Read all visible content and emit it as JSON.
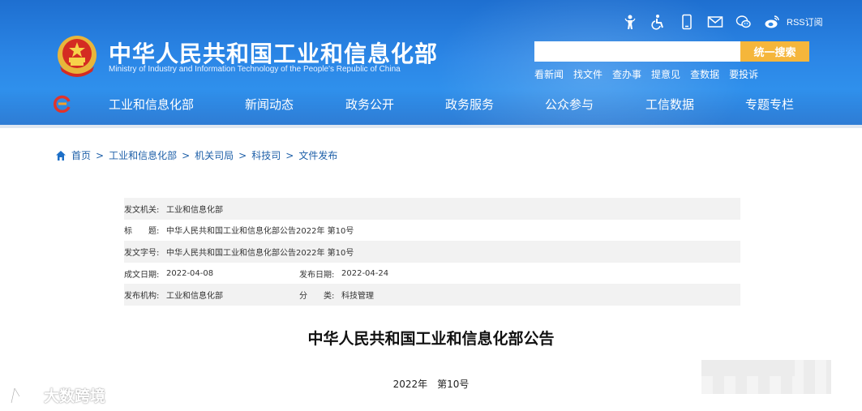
{
  "header": {
    "title": "中华人民共和国工业和信息化部",
    "subtitle": "Ministry of Industry and Information Technology of the People's Republic of China",
    "tools": [
      {
        "icon": "elder-mode-icon"
      },
      {
        "icon": "accessibility-icon"
      },
      {
        "icon": "mobile-icon"
      },
      {
        "icon": "mail-icon"
      },
      {
        "icon": "wechat-icon"
      },
      {
        "icon": "weibo-icon"
      }
    ],
    "rss_label": "RSS订阅",
    "search": {
      "placeholder": "",
      "button_label": "统一搜索"
    },
    "quick_links": [
      "看新闻",
      "找文件",
      "查办事",
      "提意见",
      "查数据",
      "要投诉"
    ],
    "nav": [
      "工业和信息化部",
      "新闻动态",
      "政务公开",
      "政务服务",
      "公众参与",
      "工信数据",
      "专题专栏"
    ],
    "colors": {
      "header_blue": "#2b86e6",
      "search_button": "#f5b63b"
    }
  },
  "breadcrumb": [
    "首页",
    "工业和信息化部",
    "机关司局",
    "科技司",
    "文件发布"
  ],
  "meta": {
    "issuer_label": "发文机关:",
    "issuer": "工业和信息化部",
    "title_label": "标　　题:",
    "title": "中华人民共和国工业和信息化部公告2022年 第10号",
    "doc_no_label": "发文字号:",
    "doc_no": "中华人民共和国工业和信息化部公告2022年 第10号",
    "created_label": "成文日期:",
    "created": "2022-04-08",
    "published_label": "发布日期:",
    "published": "2022-04-24",
    "org_label": "发布机构:",
    "org": "工业和信息化部",
    "category_label": "分　　类:",
    "category": "科技管理"
  },
  "document": {
    "title": "中华人民共和国工业和信息化部公告",
    "year": "2022年",
    "number": "第10号"
  },
  "watermark": {
    "text": "大数跨境"
  }
}
